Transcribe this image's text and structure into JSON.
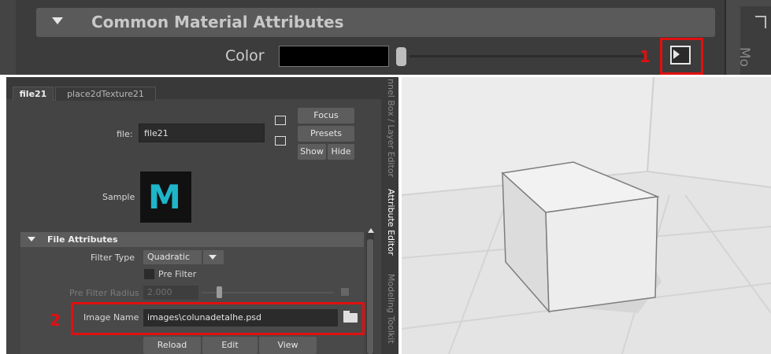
{
  "top_strip": {
    "section_title": "Common Material Attributes",
    "color_label": "Color",
    "color_value": "#000000",
    "side_tab_partial": "Mo"
  },
  "annotations": {
    "marker_1": "1",
    "marker_2": "2",
    "highlight_color": "#e01010"
  },
  "attribute_editor": {
    "tabs": [
      {
        "label": "file21",
        "active": true
      },
      {
        "label": "place2dTexture21",
        "active": false
      }
    ],
    "file_label": "file:",
    "file_value": "file21",
    "buttons": {
      "focus": "Focus",
      "presets": "Presets",
      "show": "Show",
      "hide": "Hide"
    },
    "sample_label": "Sample",
    "sample_icon": "maya-m-logo",
    "file_attributes": {
      "title": "File Attributes",
      "filter_type_label": "Filter Type",
      "filter_type_value": "Quadratic",
      "pre_filter_label": "Pre Filter",
      "pre_filter_checked": false,
      "pre_filter_radius_label": "Pre Filter Radius",
      "pre_filter_radius_value": "2.000",
      "image_name_label": "Image Name",
      "image_name_value": "images\\colunadetalhe.psd"
    },
    "action_buttons": {
      "reload": "Reload",
      "edit": "Edit",
      "view": "View"
    }
  },
  "side_tabs": [
    "nnel Box / Layer Editor",
    "Attribute Editor",
    "Modeling Toolkit"
  ],
  "viewport": {
    "background": "#e3e3e3"
  }
}
